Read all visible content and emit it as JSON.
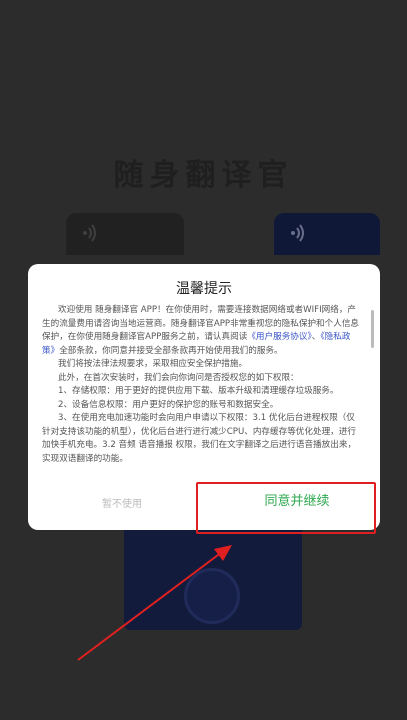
{
  "app": {
    "title": "随身翻译官"
  },
  "dialog": {
    "title": "温馨提示",
    "para1_a": "欢迎使用 随身翻译官 APP！在你使用时，需要连接数据网络或者WIFI网络，产生的流量费用请咨询当地运营商。随身翻译官APP非常重视您的隐私保护和个人信息保护，在你使用随身翻译官APP服务之前，请认真阅读",
    "link_service": "《用户服务协议》",
    "link_privacy": "《隐私政策》",
    "para1_b": "全部条款，你同意并接受全部条款再开始使用我们的服务。",
    "para2": "我们将按法律法规要求，采取相应安全保护措施。",
    "para3": "此外，在首次安装时，我们会向你询问是否授权您的如下权限：",
    "para4": "1、存储权限：用于更好的提供应用下载、版本升级和清理缓存垃圾服务。",
    "para5": "2、设备信息权限：用户更好的保护您的账号和数据安全。",
    "para6": "3、在使用充电加速功能时会向用户申请以下权限：3.1 优化后台进程权限（仅针对支持该功能的机型），优化后台进行进行减少CPU、内存缓存等优化处理，进行加快手机充电。3.2 音频 语音播报 权限，我们在文字翻译之后进行语音播放出来，实现双语翻译的功能。",
    "decline_label": "暂不使用",
    "accept_label": "同意并继续"
  },
  "colors": {
    "accent_green": "#2fa84f",
    "link_blue": "#3a55c8",
    "highlight_red": "#e02020"
  }
}
